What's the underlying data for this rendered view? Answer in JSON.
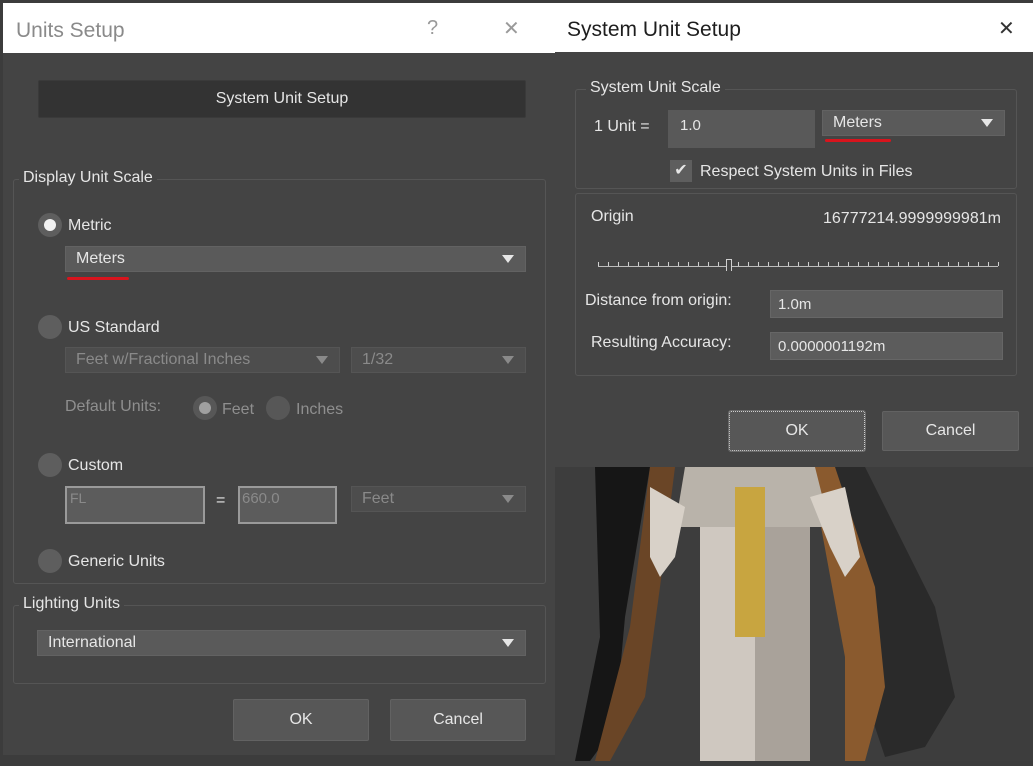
{
  "units_setup": {
    "title": "Units Setup",
    "help": "?",
    "close": "✕",
    "system_unit_setup_button": "System Unit Setup",
    "display_unit_scale": {
      "legend": "Display Unit Scale",
      "metric_label": "Metric",
      "metric_value": "Meters",
      "us_standard_label": "US Standard",
      "us_units_value": "Feet w/Fractional Inches",
      "us_fraction_value": "1/32",
      "default_units_label": "Default Units:",
      "feet_label": "Feet",
      "inches_label": "Inches",
      "custom_label": "Custom",
      "custom_name": "FL",
      "equals": "=",
      "custom_value": "660.0",
      "custom_units": "Feet",
      "generic_units_label": "Generic Units",
      "selected": "Metric"
    },
    "lighting_units": {
      "legend": "Lighting Units",
      "value": "International"
    },
    "ok_label": "OK",
    "cancel_label": "Cancel"
  },
  "system_unit_setup": {
    "title": "System Unit Setup",
    "close": "✕",
    "scale": {
      "legend": "System Unit Scale",
      "one_unit_label": "1 Unit =",
      "value": "1.0",
      "units": "Meters",
      "respect_label": "Respect System Units in Files",
      "respect_checked": true
    },
    "origin": {
      "label": "Origin",
      "value": "16777214.9999999981m",
      "distance_label": "Distance from origin:",
      "distance_value": "1.0m",
      "accuracy_label": "Resulting Accuracy:",
      "accuracy_value": "0.0000001192m"
    },
    "ok_label": "OK",
    "cancel_label": "Cancel"
  },
  "colors": {
    "dialog_bg": "#444444",
    "titlebar_bg": "#ffffff",
    "highlight_underline": "#d8141d",
    "viewport_bg": "#3c3c3c"
  }
}
